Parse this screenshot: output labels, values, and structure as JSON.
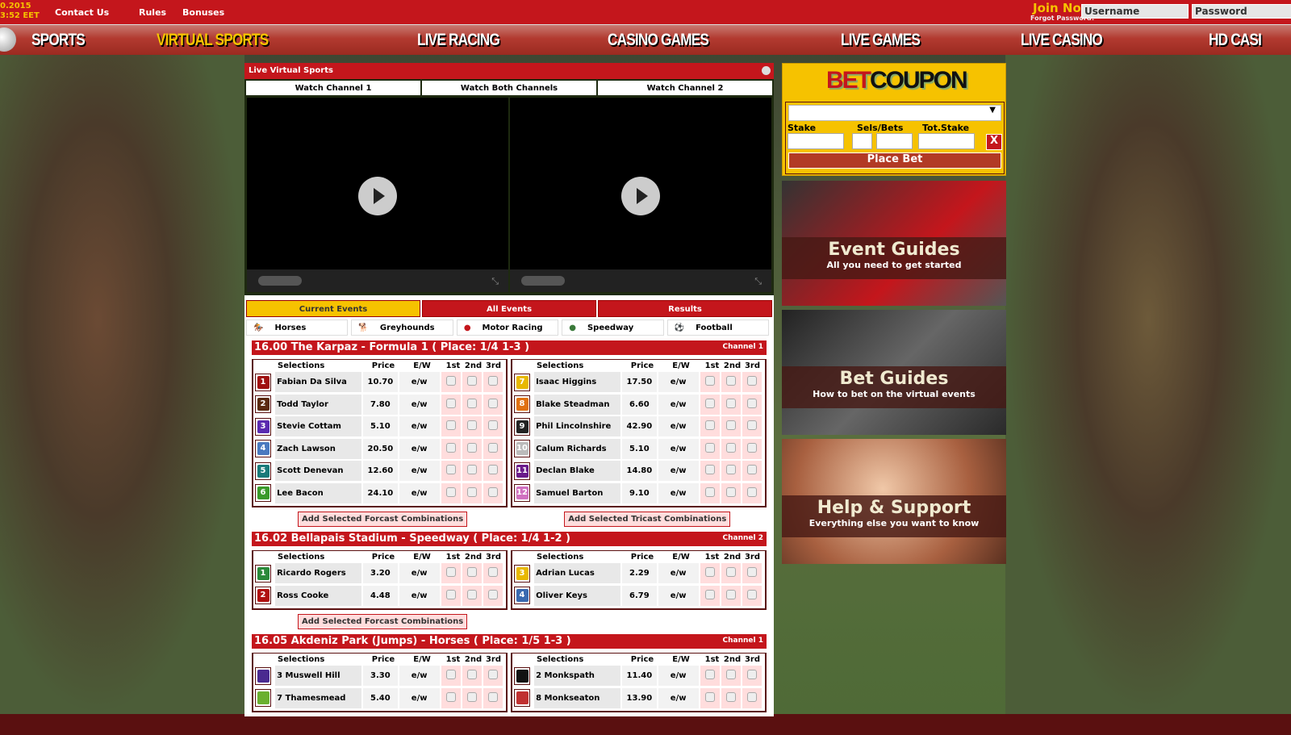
{
  "topbar": {
    "date": "0.2015",
    "time": "3:52 EET",
    "links": [
      "Contact Us",
      "Rules",
      "Bonuses"
    ],
    "join": "Join Now",
    "forgot": "Forgot Password?",
    "username_placeholder": "Username",
    "password_placeholder": "Password"
  },
  "nav": [
    "SPORTS",
    "VIRTUAL SPORTS",
    "LIVE RACING",
    "CASINO GAMES",
    "LIVE GAMES",
    "LIVE CASINO",
    "HD CASI"
  ],
  "panel": {
    "title": "Live Virtual Sports",
    "channel_tabs": [
      "Watch Channel 1",
      "Watch Both Channels",
      "Watch Channel 2"
    ],
    "event_tabs": [
      "Current Events",
      "All Events",
      "Results"
    ],
    "sport_tabs": [
      "Horses",
      "Greyhounds",
      "Motor Racing",
      "Speedway",
      "Football"
    ]
  },
  "headers": [
    "Selections",
    "Price",
    "E/W",
    "1st",
    "2nd",
    "3rd"
  ],
  "events": [
    {
      "title": "16.00 The Karpaz - Formula 1 ( Place: 1/4 1-3 )",
      "channel": "Channel 1",
      "left": [
        [
          "1",
          "Fabian Da Silva",
          "10.70",
          "e/w",
          "#a01010"
        ],
        [
          "2",
          "Todd Taylor",
          "7.80",
          "e/w",
          "#5a2a10"
        ],
        [
          "3",
          "Stevie Cottam",
          "5.10",
          "e/w",
          "#5a2ab0"
        ],
        [
          "4",
          "Zach Lawson",
          "20.50",
          "e/w",
          "#4a7ac0"
        ],
        [
          "5",
          "Scott Denevan",
          "12.60",
          "e/w",
          "#1a7a7a"
        ],
        [
          "6",
          "Lee Bacon",
          "24.10",
          "e/w",
          "#3a9a2a"
        ]
      ],
      "right": [
        [
          "7",
          "Isaac Higgins",
          "17.50",
          "e/w",
          "#e8b800"
        ],
        [
          "8",
          "Blake Steadman",
          "6.60",
          "e/w",
          "#e07010"
        ],
        [
          "9",
          "Phil Lincolnshire",
          "42.90",
          "e/w",
          "#222"
        ],
        [
          "10",
          "Calum Richards",
          "5.10",
          "e/w",
          "#bbb"
        ],
        [
          "11",
          "Declan Blake",
          "14.80",
          "e/w",
          "#6a1a8a"
        ],
        [
          "12",
          "Samuel Barton",
          "9.10",
          "e/w",
          "#d070c0"
        ]
      ],
      "buttons": [
        "Add Selected Forcast Combinations",
        "Add Selected Tricast Combinations"
      ]
    },
    {
      "title": "16.02 Bellapais Stadium - Speedway ( Place: 1/4 1-2 )",
      "channel": "Channel 2",
      "left": [
        [
          "1",
          "Ricardo Rogers",
          "3.20",
          "e/w",
          "#2a8a3a"
        ],
        [
          "2",
          "Ross Cooke",
          "4.48",
          "e/w",
          "#b01010"
        ]
      ],
      "right": [
        [
          "3",
          "Adrian Lucas",
          "2.29",
          "e/w",
          "#e8b800"
        ],
        [
          "4",
          "Oliver Keys",
          "6.79",
          "e/w",
          "#3a6ab0"
        ]
      ],
      "buttons": [
        "Add Selected Forcast Combinations"
      ]
    },
    {
      "title": "16.05 Akdeniz Park (Jumps) - Horses ( Place: 1/5 1-3 )",
      "channel": "Channel 1",
      "left": [
        [
          "",
          "3 Muswell Hill",
          "3.30",
          "e/w",
          "#4a2a90"
        ],
        [
          "",
          "7 Thamesmead",
          "5.40",
          "e/w",
          "#6ab030"
        ]
      ],
      "right": [
        [
          "",
          "2 Monkspath",
          "11.40",
          "e/w",
          "#111"
        ],
        [
          "",
          "8 Monkseaton",
          "13.90",
          "e/w",
          "#c03030"
        ]
      ],
      "buttons": []
    }
  ],
  "coupon": {
    "logo_red": "BET",
    "logo_black": "COUPON",
    "stake": "Stake",
    "sels": "Sels/Bets",
    "tot": "Tot.Stake",
    "clear": "X",
    "place": "Place Bet"
  },
  "promos": [
    {
      "title": "Event Guides",
      "sub": "All you need to get started"
    },
    {
      "title": "Bet Guides",
      "sub": "How to bet on the virtual events"
    },
    {
      "title": "Help & Support",
      "sub": "Everything else you want to know"
    }
  ],
  "colors": {
    "red": "#c4161c",
    "yellow": "#f6c200"
  }
}
